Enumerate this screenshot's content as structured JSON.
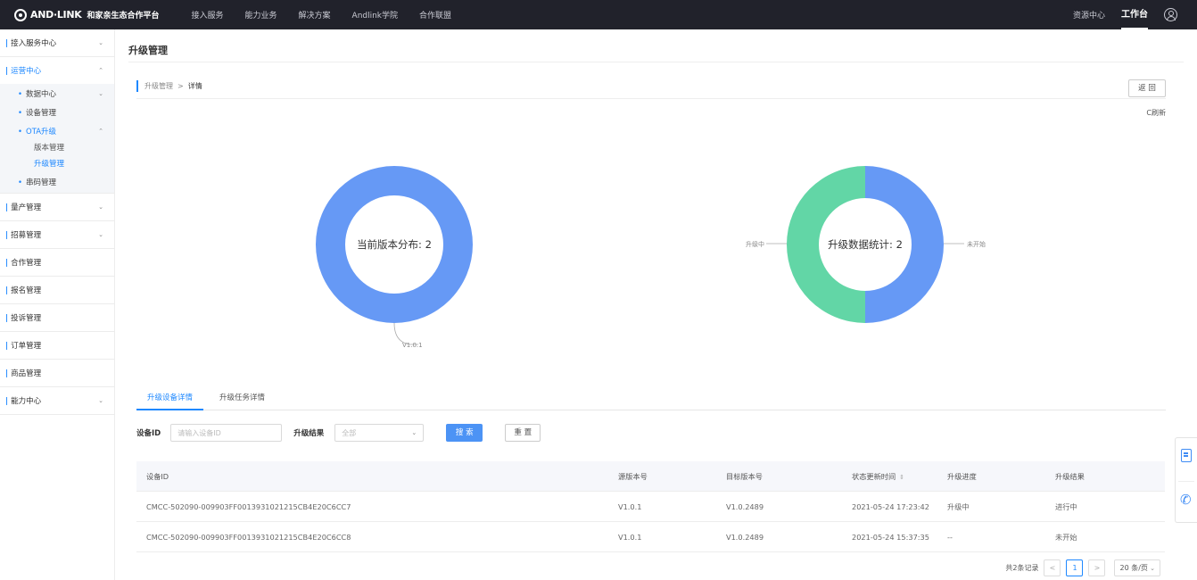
{
  "topbar": {
    "logo": "AND·LINK",
    "platform": "和家亲生态合作平台",
    "nav": [
      "接入服务",
      "能力业务",
      "解决方案",
      "Andlink学院",
      "合作联盟"
    ],
    "resource_center": "资源中心",
    "workbench": "工作台"
  },
  "sidebar": {
    "access_center": "接入服务中心",
    "ops_center": "运营中心",
    "data_center": "数据中心",
    "device_mgmt": "设备管理",
    "ota": "OTA升级",
    "version_mgmt": "版本管理",
    "upgrade_mgmt": "升级管理",
    "serial_mgmt": "串码管理",
    "mass_prod": "量产管理",
    "recruit": "招募管理",
    "coop": "合作管理",
    "signup": "报名管理",
    "complaint": "投诉管理",
    "order": "订单管理",
    "goods": "商品管理",
    "capability": "能力中心"
  },
  "page": {
    "title": "升级管理",
    "crumb_parent": "升级管理",
    "crumb_sep": ">",
    "crumb_current": "详情",
    "back": "返 回",
    "refresh": "C刷新"
  },
  "charts": {
    "left_label": "V1.0.1",
    "right_left_label": "升级中",
    "right_right_label": "未开始"
  },
  "chart_data": [
    {
      "type": "pie",
      "title": "当前版本分布: 2",
      "categories": [
        "V1.0.1"
      ],
      "values": [
        2
      ],
      "colors": [
        "#6699f5"
      ]
    },
    {
      "type": "pie",
      "title": "升级数据统计: 2",
      "categories": [
        "未开始",
        "升级中"
      ],
      "values": [
        1,
        1
      ],
      "colors": [
        "#6699f5",
        "#62d6a6"
      ]
    }
  ],
  "tabs": [
    "升级设备详情",
    "升级任务详情"
  ],
  "filter": {
    "device_id_label": "设备ID",
    "device_id_placeholder": "请输入设备ID",
    "result_label": "升级结果",
    "result_value": "全部",
    "search": "搜 索",
    "reset": "重 置"
  },
  "table": {
    "headers": [
      "设备ID",
      "源版本号",
      "目标版本号",
      "状态更新时间",
      "升级进度",
      "升级结果"
    ],
    "rows": [
      [
        "CMCC-502090-009903FF0013931021215CB4E20C6CC7",
        "V1.0.1",
        "V1.0.2489",
        "2021-05-24 17:23:42",
        "升级中",
        "进行中"
      ],
      [
        "CMCC-502090-009903FF0013931021215CB4E20C6CC8",
        "V1.0.1",
        "V1.0.2489",
        "2021-05-24 15:37:35",
        "--",
        "未开始"
      ]
    ]
  },
  "pager": {
    "total": "共2条记录",
    "prev": "<",
    "page": "1",
    "next": ">",
    "size": "20 条/页"
  }
}
